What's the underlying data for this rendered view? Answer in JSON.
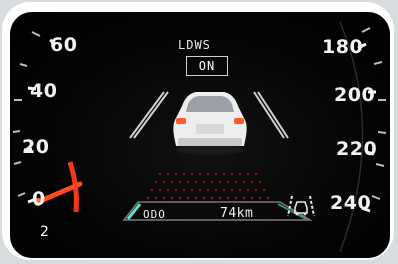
{
  "speedometer_left": {
    "labels": [
      "60",
      "40",
      "20",
      "0"
    ],
    "needle_speed": 0
  },
  "speedometer_right": {
    "labels": [
      "180",
      "200",
      "220",
      "240"
    ]
  },
  "ldws": {
    "title": "LDWS",
    "status": "ON"
  },
  "odometer": {
    "label": "ODO",
    "value": "74km"
  },
  "icons": {
    "lane_assist": "lane-assist-icon",
    "car": "car-icon"
  },
  "figure_number": "2",
  "colors": {
    "needle": "#ff4a1a",
    "lane_lines": "#cfcfcf",
    "car": "#f4f4f4",
    "tail_lights": "#ff5a2a"
  }
}
